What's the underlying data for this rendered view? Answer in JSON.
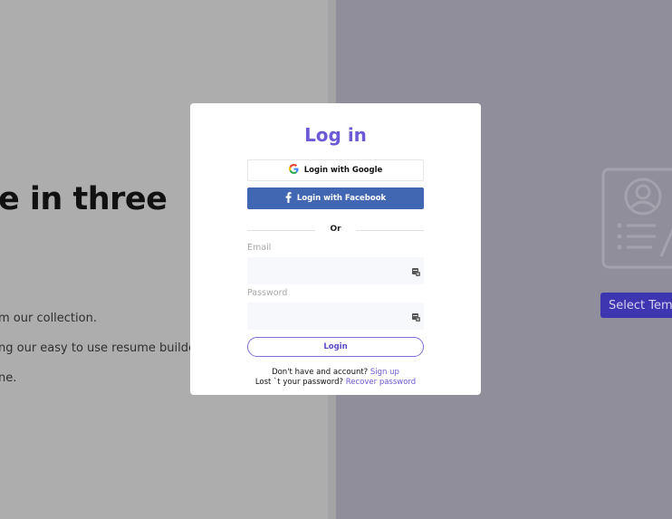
{
  "background": {
    "hero_title": "e in three",
    "hero_lines": [
      "m our collection.",
      "ng our easy to use resume builder .",
      "ne."
    ],
    "cta_label": "Select Temp",
    "colors": {
      "left": "#adadad",
      "right": "#8f8e9a",
      "cta": "#3e35b0"
    }
  },
  "modal": {
    "title": "Log in",
    "google_label": "Login with Google",
    "facebook_label": "Login with Facebook",
    "or_label": "Or",
    "email_label": "Email",
    "email_value": "",
    "password_label": "Password",
    "password_value": "",
    "login_label": "Login",
    "signup_prompt": "Don't have and account?",
    "signup_link": "Sign up",
    "recover_prompt": "Lost `t your password?",
    "recover_link": "Recover password",
    "colors": {
      "accent": "#6c5ad6",
      "facebook": "#4267b2"
    }
  }
}
